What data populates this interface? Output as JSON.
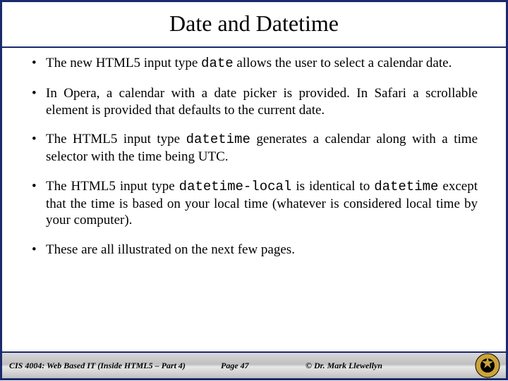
{
  "title": "Date and Datetime",
  "bullets": [
    {
      "pre": "The new HTML5 input type ",
      "code": "date",
      "post": " allows the user to select a calendar date."
    },
    {
      "pre": "In Opera, a calendar with a date picker is provided.  In Safari a scrollable element is provided that defaults to the current date.",
      "code": "",
      "post": ""
    },
    {
      "pre": "The HTML5 input type ",
      "code": "datetime",
      "post": " generates a calendar along with a time selector with the time being UTC."
    },
    {
      "pre": "The HTML5 input type ",
      "code": "datetime-local",
      "post": " is identical to ",
      "code2": "datetime",
      "post2": " except that the time is based on your local time (whatever is considered local time by your computer)."
    },
    {
      "pre": "These are all illustrated on the next few pages.",
      "code": "",
      "post": ""
    }
  ],
  "footer": {
    "course": "CIS 4004: Web Based IT (Inside HTML5 – Part 4)",
    "page": "Page 47",
    "copyright": "© Dr. Mark Llewellyn"
  }
}
